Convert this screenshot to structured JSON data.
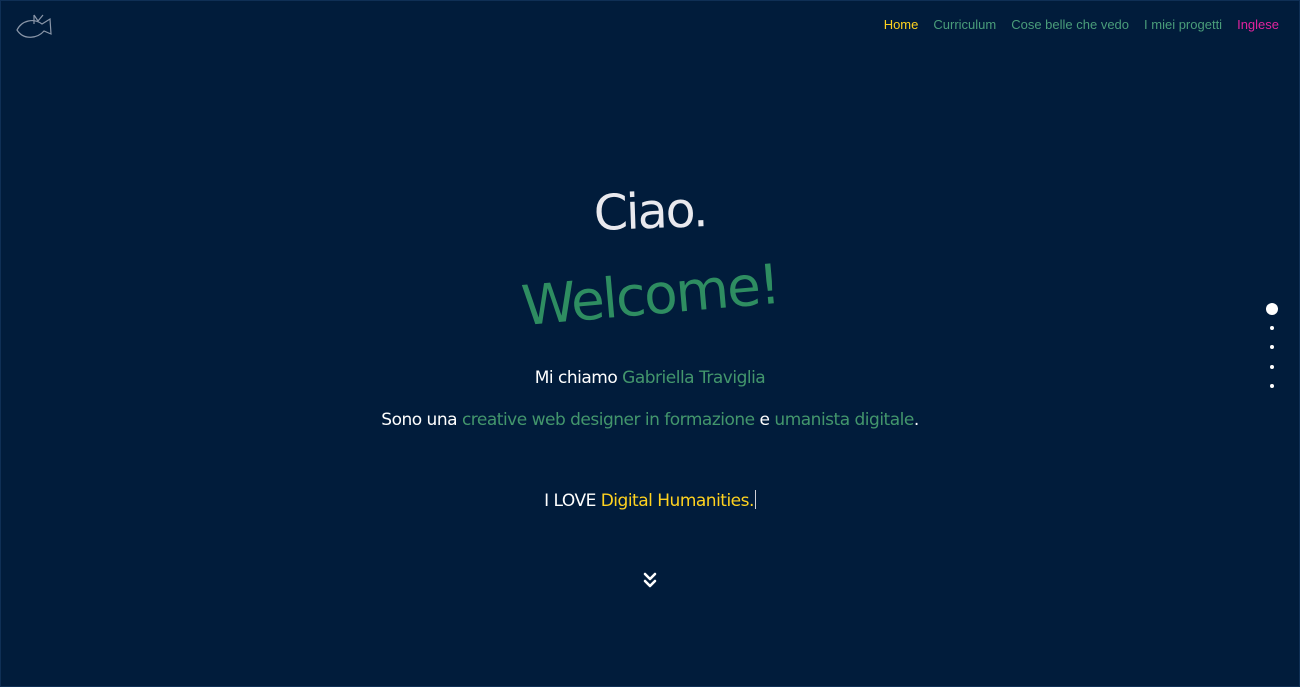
{
  "logo": {
    "icon": "fish-logo-icon",
    "color": "#8a96a8"
  },
  "nav": {
    "items": [
      {
        "label": "Home",
        "state": "active",
        "color": "#ffd21f"
      },
      {
        "label": "Curriculum",
        "color": "#4a9d7a"
      },
      {
        "label": "Cose belle che vedo",
        "color": "#4a9d7a"
      },
      {
        "label": "I miei progetti",
        "color": "#4a9d7a"
      },
      {
        "label": "Inglese",
        "color": "#e0239e"
      }
    ]
  },
  "hero": {
    "greeting": "Ciao.",
    "welcome": "Welcome!",
    "intro": {
      "prefix": "Mi chiamo ",
      "name": "Gabriella Traviglia"
    },
    "role": {
      "prefix": "Sono una ",
      "role1": "creative web designer in formazione",
      "connector": " e ",
      "role2": "umanista digitale",
      "suffix": "."
    },
    "love": {
      "prefix": "I LOVE ",
      "subject": "Digital Humanities."
    }
  },
  "scroll_icon": "double-chevron-down-icon",
  "section_dots": {
    "count": 5,
    "active_index": 0
  },
  "colors": {
    "background": "#011c3b",
    "accent_green": "#2e8d61",
    "accent_yellow": "#ffd21f",
    "accent_pink": "#e0239e",
    "text": "#ffffff"
  }
}
